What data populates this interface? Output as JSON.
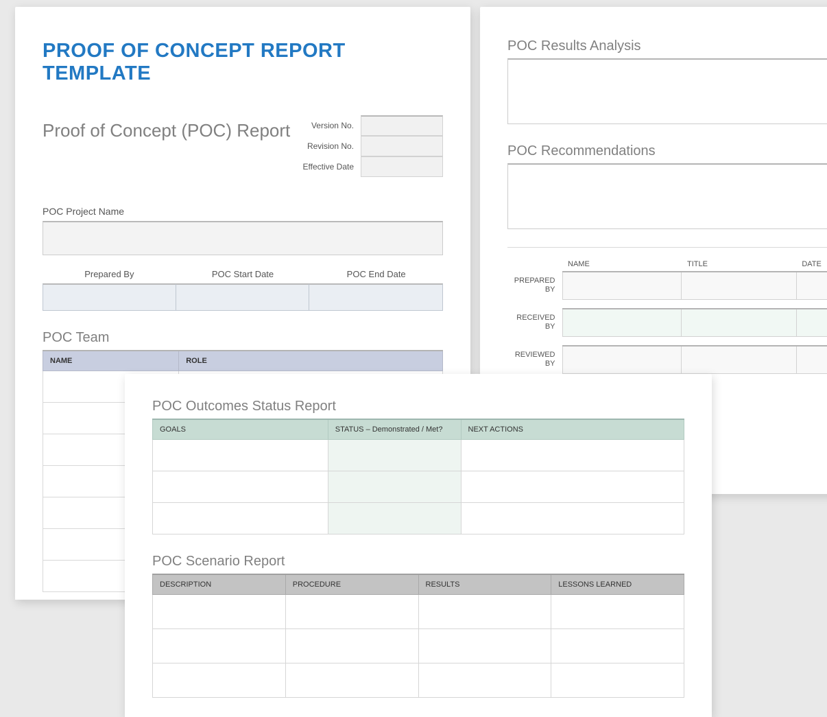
{
  "page1": {
    "title": "PROOF OF CONCEPT REPORT TEMPLATE",
    "subtitle": "Proof of Concept (POC) Report",
    "meta": {
      "version_label": "Version No.",
      "revision_label": "Revision No.",
      "effective_label": "Effective Date"
    },
    "project_name_label": "POC Project Name",
    "triple": {
      "prepared_by": "Prepared By",
      "start_date": "POC Start Date",
      "end_date": "POC End Date"
    },
    "team": {
      "section_title": "POC Team",
      "headers": {
        "name": "NAME",
        "role": "ROLE"
      }
    }
  },
  "page2": {
    "results_title": "POC Results Analysis",
    "recommendations_title": "POC Recommendations",
    "sign": {
      "headers": {
        "name": "NAME",
        "title": "TITLE",
        "date": "DATE"
      },
      "rows": {
        "prepared": "PREPARED BY",
        "received": "RECEIVED BY",
        "reviewed": "REVIEWED BY"
      }
    }
  },
  "page3": {
    "outcomes_title": "POC Outcomes Status Report",
    "outcomes_headers": {
      "goals": "GOALS",
      "status": "STATUS – Demonstrated / Met?",
      "next": "NEXT ACTIONS"
    },
    "scenario_title": "POC Scenario Report",
    "scenario_headers": {
      "description": "DESCRIPTION",
      "procedure": "PROCEDURE",
      "results": "RESULTS",
      "lessons": "LESSONS LEARNED"
    }
  }
}
